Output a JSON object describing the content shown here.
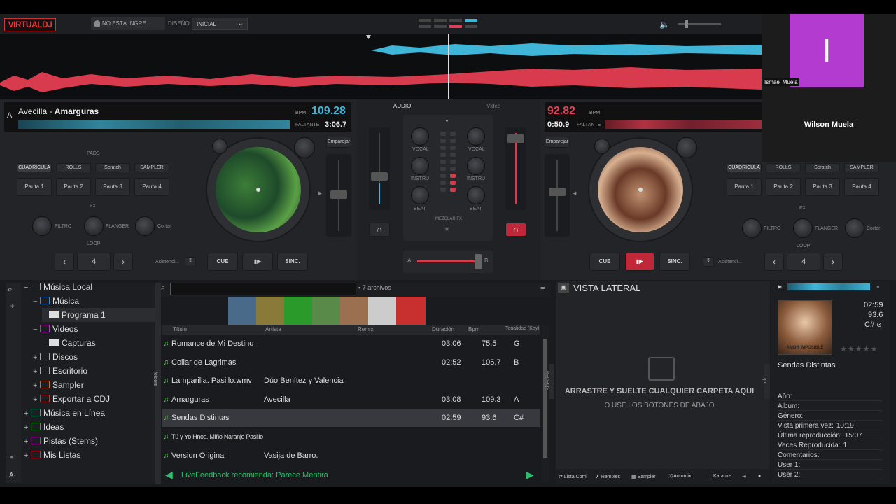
{
  "app": {
    "logo": "VIRTUALDJ",
    "login": "NO ESTÁ INGRE...",
    "design_label": "DISEÑO",
    "design_value": "INICIAL"
  },
  "deck_a": {
    "letter": "A",
    "artist": "Avecilla",
    "sep": " - ",
    "title": "Amarguras",
    "bpm_label": "BPM",
    "bpm": "109.28",
    "remaining_label": "FALTANTE",
    "remaining": "3:06.7",
    "pads_label": "PADS",
    "pad_modes": [
      "CUADRICULA",
      "ROLLS",
      "Scratch",
      "SAMPLER"
    ],
    "pads": [
      "Pauta 1",
      "Pauta 2",
      "Pauta 3",
      "Pauta 4"
    ],
    "fx_label": "FX",
    "fx": [
      "FILTRO",
      "FLANGER",
      "Cortar"
    ],
    "loop_label": "LOOP",
    "loop_value": "4",
    "assist": "Asistenci...",
    "match": "Emparejar",
    "cue": "CUE",
    "play": "▮▶",
    "sync": "SINC."
  },
  "deck_b": {
    "bpm": "92.82",
    "bpm_label": "BPM",
    "elapsed": "0:50.9",
    "remaining_label": "FALTANTE",
    "pad_modes": [
      "CUADRICULA",
      "ROLLS",
      "Scratch",
      "SAMPLER"
    ],
    "pads": [
      "Pauta 1",
      "Pauta 2",
      "Pauta 3",
      "Pauta 4"
    ],
    "fx_label": "FX",
    "fx": [
      "FILTRO",
      "FLANGER",
      "Cortar"
    ],
    "loop_label": "LOOP",
    "loop_value": "4",
    "assist": "Asistenci...",
    "match": "Emparejar",
    "cue": "CUE",
    "play": "▮▶",
    "sync": "SINC."
  },
  "mixer": {
    "tab_audio": "AUDIO",
    "tab_video": "Video",
    "eq": [
      "VOCAL",
      "INSTRU",
      "BEAT"
    ],
    "mix_fx": "MEZCLAR FX",
    "cross_a": "A",
    "cross_b": "B"
  },
  "video_call": {
    "host_initial": "I",
    "host_name": "Ismael Muela",
    "guest_name": "Wilson Muela",
    "host_color": "#b43bd0"
  },
  "tree": [
    {
      "label": "Música Local",
      "sign": "−",
      "indent": 0,
      "color": "#aaa"
    },
    {
      "label": "Música",
      "sign": "−",
      "indent": 1,
      "color": "#3a8fd8"
    },
    {
      "label": "Programa 1",
      "sign": "",
      "indent": 2,
      "color": "#ddd"
    },
    {
      "label": "Videos",
      "sign": "−",
      "indent": 1,
      "color": "#c030c0"
    },
    {
      "label": "Capturas",
      "sign": "",
      "indent": 2,
      "color": "#ddd"
    },
    {
      "label": "Discos",
      "sign": "+",
      "indent": 1,
      "color": "#aaa"
    },
    {
      "label": "Escritorio",
      "sign": "+",
      "indent": 1,
      "color": "#aaa"
    },
    {
      "label": "Sampler",
      "sign": "+",
      "indent": 1,
      "color": "#e07020"
    },
    {
      "label": "Exportar a CDJ",
      "sign": "+",
      "indent": 1,
      "color": "#c03040"
    },
    {
      "label": "Música en Línea",
      "sign": "+",
      "indent": 0,
      "color": "#30b080"
    },
    {
      "label": "Ideas",
      "sign": "+",
      "indent": 0,
      "color": "#30b030"
    },
    {
      "label": "Pistas (Stems)",
      "sign": "+",
      "indent": 0,
      "color": "#c030c0"
    },
    {
      "label": "Mis Listas",
      "sign": "+",
      "indent": 0,
      "color": "#d03040"
    }
  ],
  "list": {
    "count": "7 archivos",
    "headers": [
      "Título",
      "Artista",
      "Remix",
      "Duración",
      "Bpm",
      "Tonalidad (Key)"
    ],
    "rows": [
      {
        "title": "Romance de Mi Destino",
        "artist": "",
        "dur": "03:06",
        "bpm": "75.5",
        "key": "G"
      },
      {
        "title": "Collar de Lagrimas",
        "artist": "",
        "dur": "02:52",
        "bpm": "105.7",
        "key": "B"
      },
      {
        "title": "Lamparilla. Pasillo.wmv",
        "artist": "Dúo Benítez y Valencia",
        "dur": "",
        "bpm": "",
        "key": ""
      },
      {
        "title": "Amarguras",
        "artist": "Avecilla",
        "dur": "03:08",
        "bpm": "109.3",
        "key": "A"
      },
      {
        "title": "Sendas Distintas",
        "artist": "",
        "dur": "02:59",
        "bpm": "93.6",
        "key": "C#"
      },
      {
        "title": "Tú y Yo  Hnos. Miño Naranjo  Pasillo",
        "artist": "",
        "dur": "",
        "bpm": "",
        "key": ""
      },
      {
        "title": "Version Original",
        "artist": "Vasija de Barro.",
        "dur": "",
        "bpm": "",
        "key": ""
      }
    ],
    "feedback": "LiveFeedback recomienda: Parece Mentira",
    "side_tab_left": "folders",
    "side_tab_right": "sideview"
  },
  "sideview": {
    "title": "VISTA LATERAL",
    "drop1": "ARRASTRE Y SUELTE CUALQUIER CARPETA AQUI",
    "drop2": "O USE LOS BOTONES DE ABAJO",
    "tabs": [
      "Lista Corri",
      "Remixes",
      "Sampler",
      "Automix",
      "Karaoke"
    ],
    "info_tab": "info"
  },
  "info": {
    "time": "02:59",
    "bpm": "93.6",
    "key": "C#",
    "cover_text": "AMOR IMPOSIBLE",
    "title": "Sendas Distintas",
    "fields": [
      {
        "label": "Año:",
        "value": ""
      },
      {
        "label": "Álbum:",
        "value": ""
      },
      {
        "label": "Género:",
        "value": ""
      },
      {
        "label": "Vista primera vez:",
        "value": "10:19"
      },
      {
        "label": "Última reproducción:",
        "value": "15:07"
      },
      {
        "label": "Veces Reproducida:",
        "value": "1"
      },
      {
        "label": "Comentarios:",
        "value": ""
      },
      {
        "label": "User 1:",
        "value": ""
      },
      {
        "label": "User 2:",
        "value": ""
      }
    ]
  },
  "colors": {
    "deck_a": "#3fb6d8",
    "deck_b": "#e04055",
    "accent_red": "#c0283a"
  }
}
